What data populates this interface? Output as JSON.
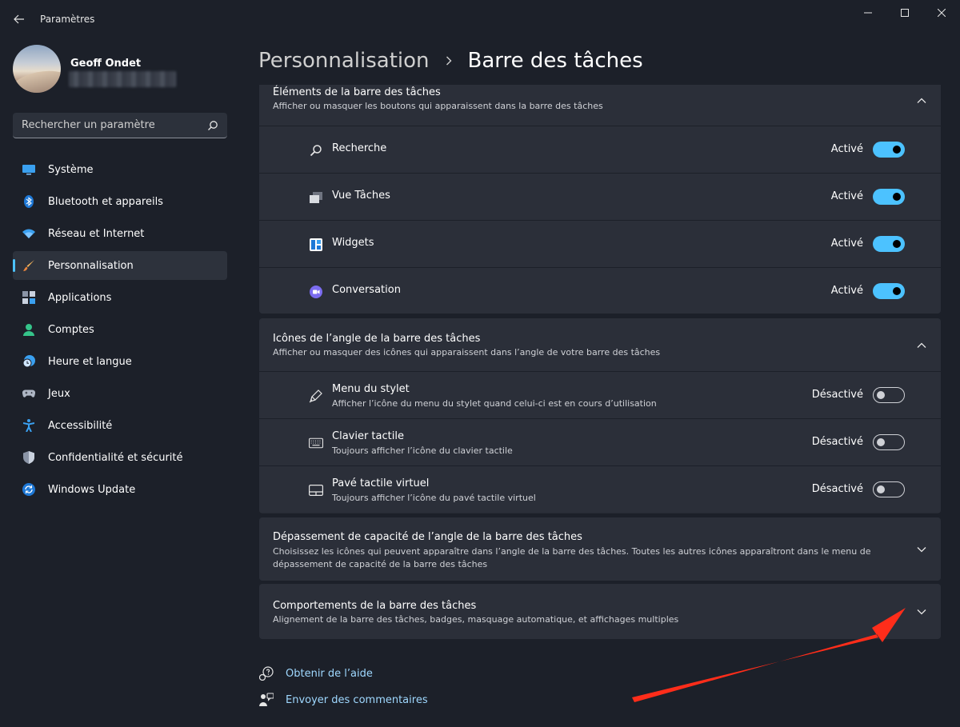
{
  "window": {
    "title": "Paramètres"
  },
  "user": {
    "name": "Geoff Ondet"
  },
  "search": {
    "placeholder": "Rechercher un paramètre"
  },
  "sidebar": {
    "items": [
      {
        "label": "Système",
        "icon": "system-icon"
      },
      {
        "label": "Bluetooth et appareils",
        "icon": "bluetooth-icon"
      },
      {
        "label": "Réseau et Internet",
        "icon": "wifi-icon"
      },
      {
        "label": "Personnalisation",
        "icon": "brush-icon",
        "active": true
      },
      {
        "label": "Applications",
        "icon": "apps-icon"
      },
      {
        "label": "Comptes",
        "icon": "account-icon"
      },
      {
        "label": "Heure et langue",
        "icon": "time-language-icon"
      },
      {
        "label": "Jeux",
        "icon": "gamepad-icon"
      },
      {
        "label": "Accessibilité",
        "icon": "accessibility-icon"
      },
      {
        "label": "Confidentialité et sécurité",
        "icon": "shield-icon"
      },
      {
        "label": "Windows Update",
        "icon": "update-icon"
      }
    ]
  },
  "breadcrumb": {
    "parent": "Personnalisation",
    "current": "Barre des tâches"
  },
  "sections": {
    "items": {
      "title": "Éléments de la barre des tâches",
      "subtitle": "Afficher ou masquer les boutons qui apparaissent dans la barre des tâches",
      "rows": [
        {
          "label": "Recherche",
          "state": "Activé",
          "on": true,
          "icon": "search-icon"
        },
        {
          "label": "Vue Tâches",
          "state": "Activé",
          "on": true,
          "icon": "task-view-icon"
        },
        {
          "label": "Widgets",
          "state": "Activé",
          "on": true,
          "icon": "widgets-icon"
        },
        {
          "label": "Conversation",
          "state": "Activé",
          "on": true,
          "icon": "chat-icon"
        }
      ]
    },
    "corner_icons": {
      "title": "Icônes de l’angle de la barre des tâches",
      "subtitle": "Afficher ou masquer des icônes qui apparaissent dans l’angle de votre barre des tâches",
      "rows": [
        {
          "label": "Menu du stylet",
          "sub": "Afficher l’icône du menu du stylet quand celui-ci est en cours d’utilisation",
          "state": "Désactivé",
          "on": false,
          "icon": "pen-icon"
        },
        {
          "label": "Clavier tactile",
          "sub": "Toujours afficher l’icône du clavier tactile",
          "state": "Désactivé",
          "on": false,
          "icon": "keyboard-icon"
        },
        {
          "label": "Pavé tactile virtuel",
          "sub": "Toujours afficher l’icône du pavé tactile virtuel",
          "state": "Désactivé",
          "on": false,
          "icon": "touchpad-icon"
        }
      ]
    },
    "overflow": {
      "title": "Dépassement de capacité de l’angle de la barre des tâches",
      "subtitle": "Choisissez les icônes qui peuvent apparaître dans l’angle de la barre des tâches. Toutes les autres icônes apparaîtront dans le menu de dépassement de capacité de la barre des tâches"
    },
    "behaviors": {
      "title": "Comportements de la barre des tâches",
      "subtitle": "Alignement de la barre des tâches, badges, masquage automatique, et affichages multiples"
    }
  },
  "footer": {
    "help": "Obtenir de l’aide",
    "feedback": "Envoyer des commentaires"
  },
  "colors": {
    "accent": "#4cc2ff",
    "background": "#1c2029",
    "card": "#2b2f39",
    "annotation_arrow": "#ff2d1a"
  }
}
